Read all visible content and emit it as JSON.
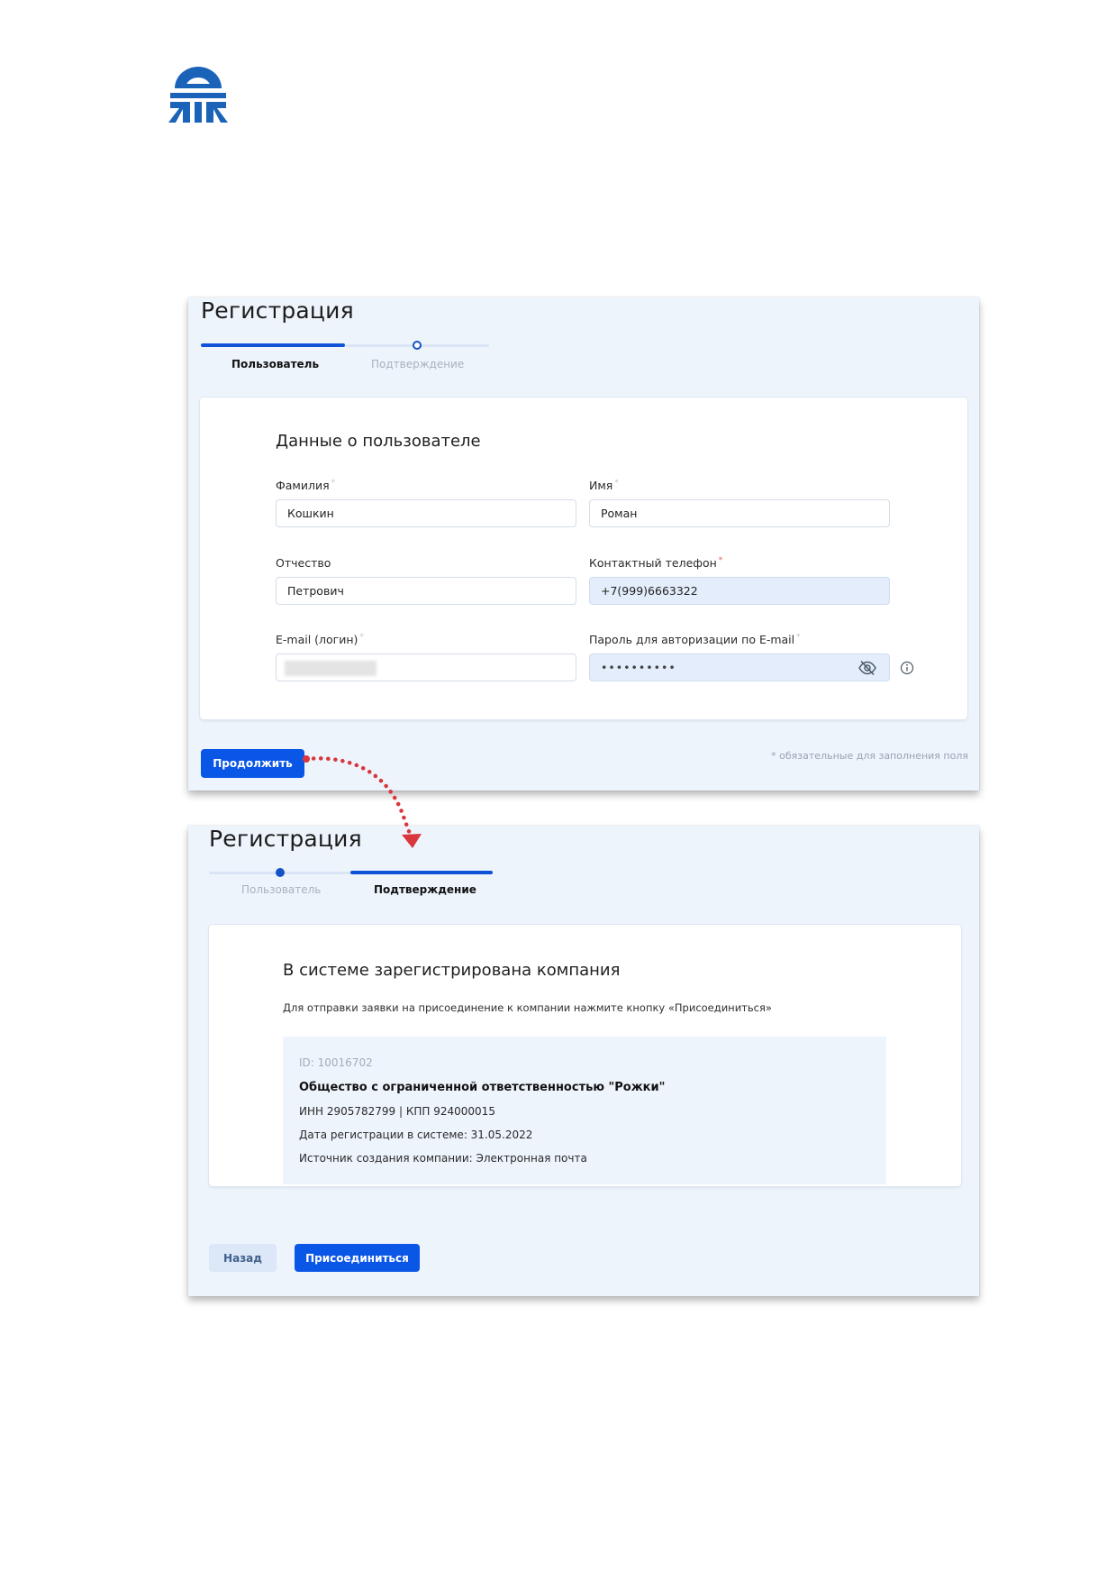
{
  "page1": {
    "title": "Регистрация",
    "steps": [
      {
        "label": "Пользователь",
        "active": true
      },
      {
        "label": "Подтверждение",
        "active": false
      }
    ],
    "card_title": "Данные о пользователе",
    "fields": {
      "last_name": {
        "label": "Фамилия",
        "value": "Кошкин"
      },
      "first_name": {
        "label": "Имя",
        "value": "Роман"
      },
      "middle_name": {
        "label": "Отчество",
        "value": "Петрович"
      },
      "phone": {
        "label": "Контактный телефон",
        "value": "+7(999)6663322"
      },
      "email": {
        "label": "E-mail (логин)",
        "value": ""
      },
      "password": {
        "label": "Пароль для авторизации по E-mail",
        "value": "••••••••••"
      }
    },
    "required_mark": "*",
    "continue_label": "Продолжить",
    "required_note": "* обязательные для заполнения поля"
  },
  "page2": {
    "title": "Регистрация",
    "steps": [
      {
        "label": "Пользователь",
        "active": false
      },
      {
        "label": "Подтверждение",
        "active": true
      }
    ],
    "card_title": "В системе зарегистрирована компания",
    "description": "Для отправки заявки на присоединение к компании нажмите кнопку «Присоединиться»",
    "company": {
      "id": "ID: 10016702",
      "name": "Общество с ограниченной ответственностью \"Рожки\"",
      "inn_kpp": "ИНН 2905782799 | КПП 924000015",
      "reg_date": "Дата регистрации в системе: 31.05.2022",
      "source": "Источник создания компании: Электронная почта"
    },
    "back_label": "Назад",
    "join_label": "Присоединиться"
  },
  "colors": {
    "primary": "#0a56e6",
    "panel_bg": "#eef4fc",
    "step_active": "#0e52d8",
    "arrow": "#d9363e",
    "logo": "#1a63b8"
  },
  "icons": {
    "logo": "company-logo",
    "eye": "eye-slash-icon",
    "info": "info-icon",
    "arrow": "dotted-arrow"
  }
}
